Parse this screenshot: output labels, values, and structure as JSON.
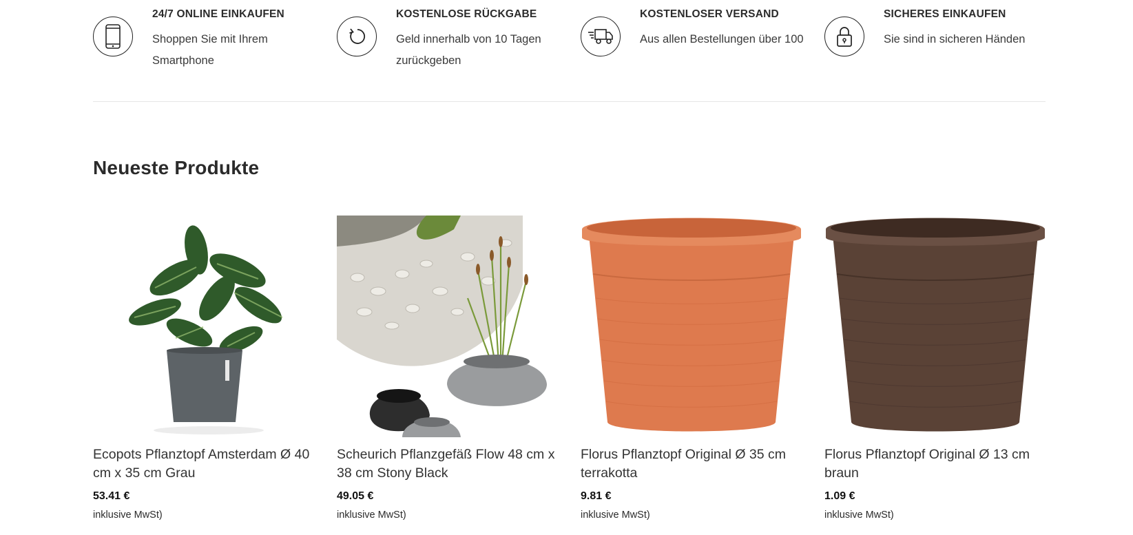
{
  "features": [
    {
      "icon": "smartphone-icon",
      "title": "24/7 ONLINE EINKAUFEN",
      "text": "Shoppen Sie mit Ihrem Smartphone"
    },
    {
      "icon": "return-arrow-icon",
      "title": "KOSTENLOSE RÜCKGABE",
      "text": "Geld innerhalb von 10 Tagen zurückgeben"
    },
    {
      "icon": "delivery-truck-icon",
      "title": "KOSTENLOSER VERSAND",
      "text": "Aus allen Bestellungen über 100"
    },
    {
      "icon": "padlock-icon",
      "title": "SICHERES EINKAUFEN",
      "text": "Sie sind in sicheren Händen"
    }
  ],
  "section": {
    "title": "Neueste Produkte"
  },
  "products": [
    {
      "name": "Ecopots Pflanztopf Amsterdam Ø 40 cm x 35 cm Grau",
      "price": "53.41 €",
      "tax": "inklusive MwSt)",
      "image": "potted-calathea-grey-planter"
    },
    {
      "name": "Scheurich Pflanzgefäß Flow 48 cm x 38 cm Stony Black",
      "price": "49.05 €",
      "tax": "inklusive MwSt)",
      "image": "stone-shaped-planters-with-grass"
    },
    {
      "name": "Florus Pflanztopf Original Ø 35 cm terrakotta",
      "price": "9.81 €",
      "tax": "inklusive MwSt)",
      "image": "terracotta-plastic-pot"
    },
    {
      "name": "Florus Pflanztopf Original Ø 13 cm braun",
      "price": "1.09 €",
      "tax": "inklusive MwSt)",
      "image": "brown-plastic-pot"
    }
  ],
  "colors": {
    "text": "#2b2b2b",
    "divider": "#e6e6e6",
    "terracotta": "#de7a4e",
    "brown": "#5a4236"
  }
}
